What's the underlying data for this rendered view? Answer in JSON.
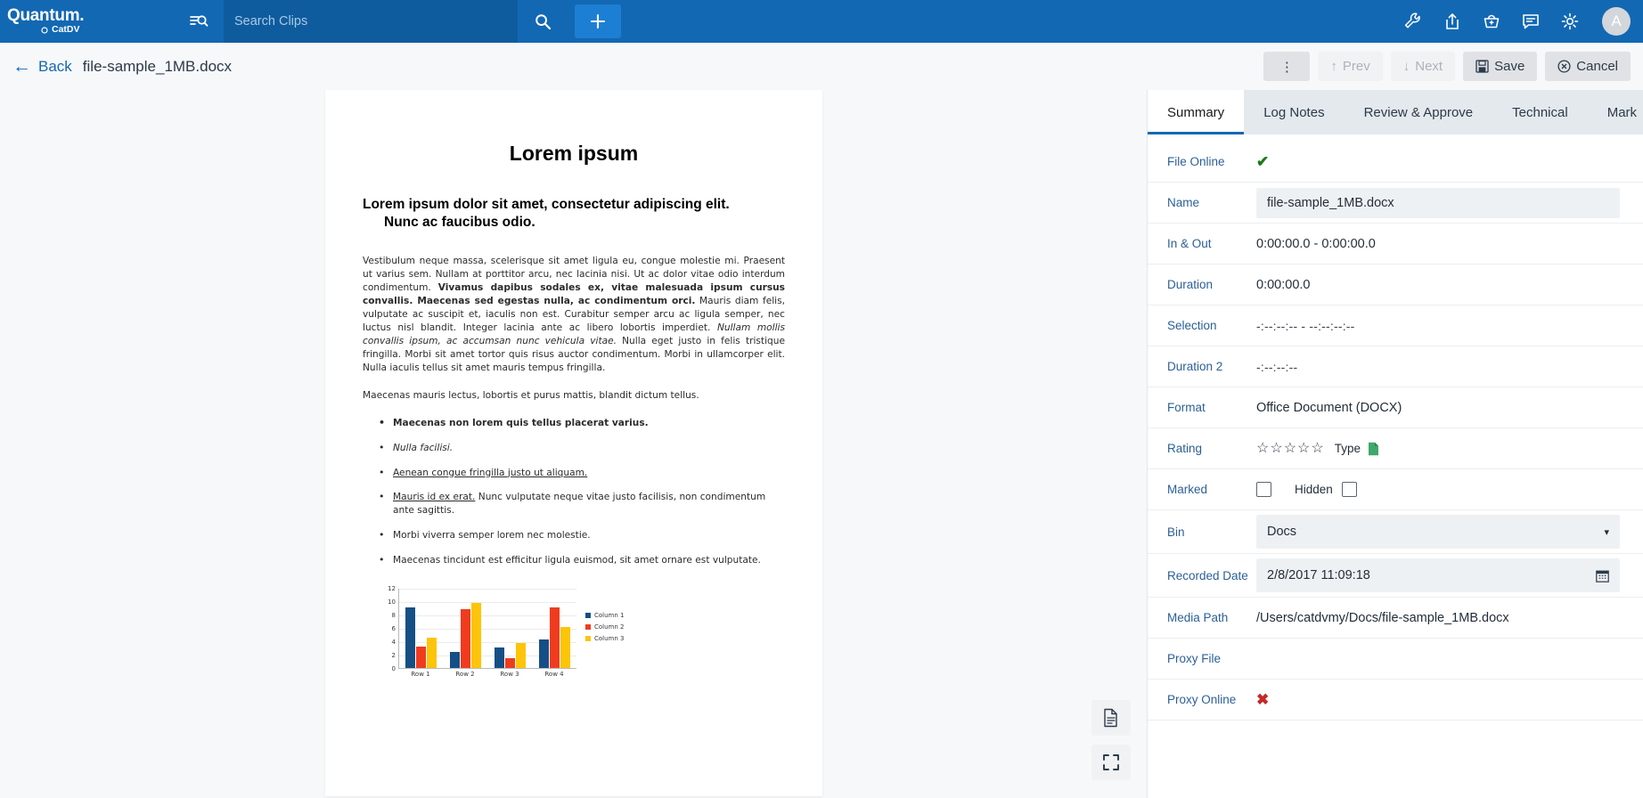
{
  "topbar": {
    "brand": "Quantum.",
    "brand_sub": "CatDV",
    "filter_icon": "filter-search-icon",
    "search": {
      "placeholder": "Search Clips",
      "value": ""
    },
    "search_icon": "search-icon",
    "add_label": "+",
    "icons": [
      {
        "name": "wrench-icon",
        "label": "Tools"
      },
      {
        "name": "share-upload-icon",
        "label": "Share"
      },
      {
        "name": "basket-icon",
        "label": "Basket"
      },
      {
        "name": "comment-icon",
        "label": "Comments"
      },
      {
        "name": "gear-icon",
        "label": "Settings"
      }
    ],
    "avatar_initial": "A"
  },
  "actionbar": {
    "back_label": "Back",
    "file_title": "file-sample_1MB.docx",
    "kebab_label": "⋮",
    "prev_label": "Prev",
    "next_label": "Next",
    "save_label": "Save",
    "cancel_label": "Cancel"
  },
  "tabs": [
    {
      "label": "Summary",
      "active": true
    },
    {
      "label": "Log Notes",
      "active": false
    },
    {
      "label": "Review & Approve",
      "active": false
    },
    {
      "label": "Technical",
      "active": false
    },
    {
      "label": "Mark",
      "active": false
    }
  ],
  "tabs_more_icon": "chevron-right-icon",
  "fields": {
    "file_online": {
      "label": "File Online",
      "value": "✔"
    },
    "name": {
      "label": "Name",
      "value": "file-sample_1MB.docx"
    },
    "in_out": {
      "label": "In & Out",
      "value": "0:00:00.0 - 0:00:00.0"
    },
    "duration": {
      "label": "Duration",
      "value": "0:00:00.0"
    },
    "selection": {
      "label": "Selection",
      "value": "-:--:--:-- - --:--:--:--"
    },
    "duration2": {
      "label": "Duration 2",
      "value": "-:--:--:--"
    },
    "format": {
      "label": "Format",
      "value": "Office Document (DOCX)"
    },
    "rating": {
      "label": "Rating",
      "stars": 5,
      "filled": 0,
      "type_label": "Type",
      "type_icon": "document-green-icon"
    },
    "marked": {
      "label": "Marked",
      "checked": false,
      "hidden_label": "Hidden",
      "hidden_checked": false
    },
    "bin": {
      "label": "Bin",
      "value": "Docs",
      "caret": "▾"
    },
    "recorded_date": {
      "label": "Recorded Date",
      "value": "2/8/2017 11:09:18",
      "icon": "calendar-icon"
    },
    "media_path": {
      "label": "Media Path",
      "value": "/Users/catdvmy/Docs/file-sample_1MB.docx"
    },
    "proxy_file": {
      "label": "Proxy File",
      "value": ""
    },
    "proxy_online": {
      "label": "Proxy Online",
      "value": "✖"
    }
  },
  "preview": {
    "tools": [
      {
        "name": "document-page-icon"
      },
      {
        "name": "fullscreen-icon"
      }
    ],
    "document": {
      "title": "Lorem ipsum",
      "heading_line1": "Lorem ipsum dolor sit amet, consectetur adipiscing elit.",
      "heading_line2": "Nunc ac faucibus odio.",
      "para1_a": "Vestibulum neque massa, scelerisque sit amet ligula eu, congue molestie mi. Praesent ut varius sem. Nullam at porttitor arcu, nec lacinia nisi. Ut ac dolor vitae odio interdum condimentum. ",
      "para1_b": "Vivamus dapibus sodales ex, vitae malesuada ipsum cursus convallis. Maecenas sed egestas nulla, ac condimentum orci.",
      "para1_c": " Mauris diam felis, vulputate ac suscipit et, iaculis non est. Curabitur semper arcu ac ligula semper, nec luctus nisl blandit. Integer lacinia ante ac libero lobortis imperdiet. ",
      "para1_d": "Nullam mollis convallis ipsum, ac accumsan nunc vehicula vitae.",
      "para1_e": " Nulla eget justo in felis tristique fringilla. Morbi sit amet tortor quis risus auctor condimentum. Morbi in ullamcorper elit. Nulla iaculis tellus sit amet mauris tempus fringilla.",
      "para2": "Maecenas mauris lectus, lobortis et purus mattis, blandit dictum tellus.",
      "bullets": [
        {
          "text": "Maecenas non lorem quis tellus placerat varius.",
          "style": "bold"
        },
        {
          "text": "Nulla facilisi.",
          "style": "italic"
        },
        {
          "text": "Aenean congue fringilla justo ut aliquam. ",
          "style": "underline"
        },
        {
          "text_u": "Mauris id ex erat.",
          "text": " Nunc vulputate neque vitae justo facilisis, non condimentum ante sagittis.",
          "style": "mixed"
        },
        {
          "text": "Morbi viverra semper lorem nec molestie.",
          "style": "plain"
        },
        {
          "text": "Maecenas tincidunt est efficitur ligula euismod, sit amet ornare est vulputate.",
          "style": "plain"
        }
      ]
    }
  },
  "chart_data": {
    "type": "bar",
    "title": "",
    "categories": [
      "Row 1",
      "Row 2",
      "Row 3",
      "Row 4"
    ],
    "series": [
      {
        "name": "Column 1",
        "color": "#164f86",
        "values": [
          9.1,
          2.4,
          3.1,
          4.3
        ]
      },
      {
        "name": "Column 2",
        "color": "#ef3c1f",
        "values": [
          3.2,
          8.8,
          1.5,
          9.05
        ]
      },
      {
        "name": "Column 3",
        "color": "#fdc408",
        "values": [
          4.5,
          9.65,
          3.7,
          6.15
        ]
      }
    ],
    "xlabel": "",
    "ylabel": "",
    "ylim": [
      0,
      12
    ],
    "yticks": [
      0,
      2,
      4,
      6,
      8,
      10,
      12
    ],
    "grid": true,
    "legend_position": "right"
  },
  "colors": {
    "brand_blue": "#1268b3",
    "accent_blue": "#1d7fd4",
    "panel_bg": "#ffffff",
    "app_bg": "#f7f8fa",
    "tab_bg": "#e4e9ee",
    "label_blue": "#2b5f96",
    "ok_green": "#1a7a1a",
    "error_red": "#c62828"
  }
}
